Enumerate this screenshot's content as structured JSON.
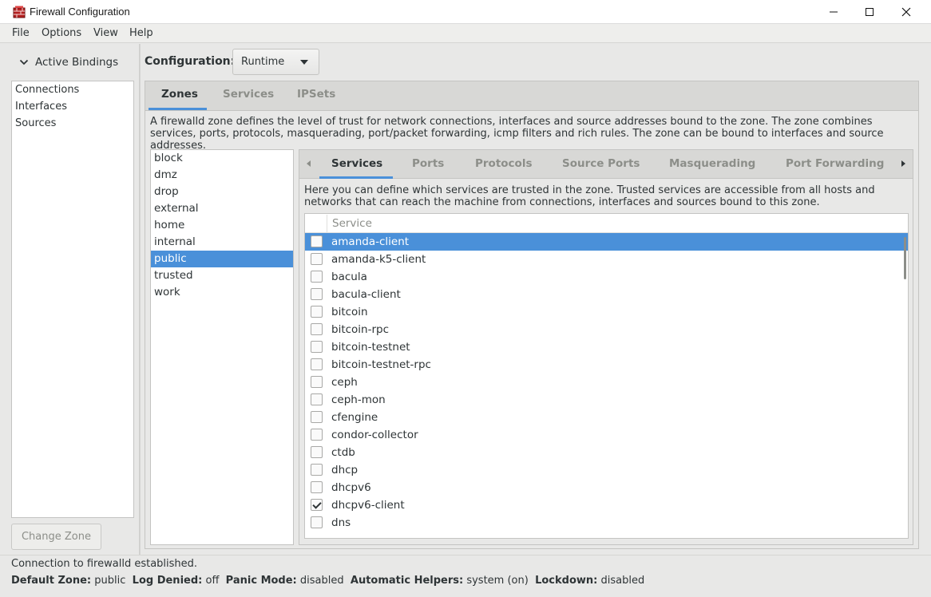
{
  "window": {
    "title": "Firewall Configuration",
    "icon": "firewall-icon",
    "controls": [
      "minimize-icon",
      "maximize-icon",
      "close-icon"
    ]
  },
  "menubar": {
    "items": [
      "File",
      "Options",
      "View",
      "Help"
    ]
  },
  "active_bindings": {
    "header": "Active Bindings",
    "items": [
      "Connections",
      "Interfaces",
      "Sources"
    ],
    "change_zone_button": "Change Zone"
  },
  "configuration": {
    "label": "Configuration:",
    "selected": "Runtime"
  },
  "outer_tabs": {
    "items": [
      "Zones",
      "Services",
      "IPSets"
    ],
    "active": "Zones"
  },
  "zone_description": "A firewalld zone defines the level of trust for network connections, interfaces and source addresses bound to the zone. The zone combines services, ports, protocols, masquerading, port/packet forwarding, icmp filters and rich rules. The zone can be bound to interfaces and source addresses.",
  "zones": {
    "items": [
      "block",
      "dmz",
      "drop",
      "external",
      "home",
      "internal",
      "public",
      "trusted",
      "work"
    ],
    "selected": "public"
  },
  "inner_tabs": {
    "items": [
      "Services",
      "Ports",
      "Protocols",
      "Source Ports",
      "Masquerading",
      "Port Forwarding"
    ],
    "active": "Services"
  },
  "services_description": "Here you can define which services are trusted in the zone. Trusted services are accessible from all hosts and networks that can reach the machine from connections, interfaces and sources bound to this zone.",
  "services_table": {
    "column_header": "Service",
    "rows": [
      {
        "name": "amanda-client",
        "checked": false,
        "selected": true
      },
      {
        "name": "amanda-k5-client",
        "checked": false,
        "selected": false
      },
      {
        "name": "bacula",
        "checked": false,
        "selected": false
      },
      {
        "name": "bacula-client",
        "checked": false,
        "selected": false
      },
      {
        "name": "bitcoin",
        "checked": false,
        "selected": false
      },
      {
        "name": "bitcoin-rpc",
        "checked": false,
        "selected": false
      },
      {
        "name": "bitcoin-testnet",
        "checked": false,
        "selected": false
      },
      {
        "name": "bitcoin-testnet-rpc",
        "checked": false,
        "selected": false
      },
      {
        "name": "ceph",
        "checked": false,
        "selected": false
      },
      {
        "name": "ceph-mon",
        "checked": false,
        "selected": false
      },
      {
        "name": "cfengine",
        "checked": false,
        "selected": false
      },
      {
        "name": "condor-collector",
        "checked": false,
        "selected": false
      },
      {
        "name": "ctdb",
        "checked": false,
        "selected": false
      },
      {
        "name": "dhcp",
        "checked": false,
        "selected": false
      },
      {
        "name": "dhcpv6",
        "checked": false,
        "selected": false
      },
      {
        "name": "dhcpv6-client",
        "checked": true,
        "selected": false
      },
      {
        "name": "dns",
        "checked": false,
        "selected": false
      }
    ]
  },
  "status": {
    "connection": "Connection to firewalld established.",
    "default_zone_label": "Default Zone:",
    "default_zone": "public",
    "log_denied_label": "Log Denied:",
    "log_denied": "off",
    "panic_mode_label": "Panic Mode:",
    "panic_mode": "disabled",
    "automatic_helpers_label": "Automatic Helpers:",
    "automatic_helpers": "system (on)",
    "lockdown_label": "Lockdown:",
    "lockdown": "disabled"
  },
  "colors": {
    "accent": "#4a90d9",
    "background": "#e8e8e7",
    "disabled_text": "#8c8e89"
  }
}
